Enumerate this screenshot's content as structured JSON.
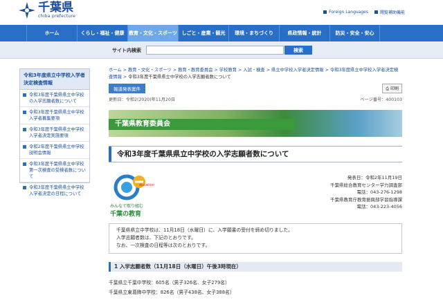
{
  "header": {
    "logo_title": "千葉県",
    "logo_sub": "chiba prefecture",
    "tools": [
      {
        "label": "Foreign Languages",
        "icon": "globe-icon"
      },
      {
        "label": "閲覧補助機能",
        "icon": "accessibility-icon"
      }
    ]
  },
  "nav": {
    "items": [
      "ホーム",
      "くらし・福祉・健康",
      "教育・文化・スポーツ",
      "しごと・産業・観光",
      "環境・まちづくり",
      "県政情報・統計",
      "防災・安全・安心"
    ],
    "active_index": 2
  },
  "search": {
    "label": "サイト内検索",
    "placeholder": "",
    "button": "検索"
  },
  "sidebar": {
    "heading": "令和3年度県立中学校入学者決定検査情報",
    "items": [
      "令和3年度千葉県県立中学校の入学志願者数について",
      "令和3年度千葉県県立中学校入学者募集要項",
      "令和3年度千葉県県立中学校入学者決定実施要項",
      "令和2年度千葉県県立中学校説明会情報",
      "令和3年度千葉県県立中学校第一次検査の受検者数について",
      "令和3年度千葉県県立中学校入学者決定の日程について"
    ]
  },
  "breadcrumb": {
    "links": [
      "ホーム",
      "教育・文化・スポーツ",
      "教育・教育委員会",
      "学校教育",
      "入試・検査",
      "県立中学校入学者決定情報",
      "令和3年度県立中学校入学者決定検査情報"
    ],
    "current": "令和3年度千葉県県立中学校の入学志願者数について"
  },
  "press_button": "報道発表案件",
  "print_button": "印刷",
  "meta": {
    "updated": "更新日：令和2(2020)年11月20日",
    "page_no": "ページ番号：400103"
  },
  "banner_title": "千葉県教育委員会",
  "page_title": "令和3年度千葉県県立中学校の入学志願者数について",
  "edu_logo": {
    "caption1": "みんなで取り組む",
    "caption2": "千葉の教育",
    "badge": "ducation"
  },
  "contact": [
    "発表日：令和2年11月19日",
    "千葉県総合教育センター学力調査部",
    "電話：043-276-1298",
    "千葉県教育庁教育振興部学習指導課",
    "電話：043-223-4056"
  ],
  "notice": [
    "千葉県県立中学校は、11月18日（水曜日）に、入学願書の受付を締め切りました。",
    "入学志願者数は、下記のとおりです。",
    "なお、一次検査の日程等は次のとおりです。"
  ],
  "section1_heading": "1 入学志願者数（11月18日（水曜日）午後3時現在）",
  "applicants": [
    "千葉県立千葉中学校：605名（男子326名、女子279名）",
    "千葉県立東葛飾中学校：826名（男子438名、女子388名）"
  ],
  "colors": {
    "nav": "#2a6fc7",
    "nav_active": "#6fa8e6",
    "banner": "#3a9a3a",
    "link": "#1b4f9c"
  }
}
